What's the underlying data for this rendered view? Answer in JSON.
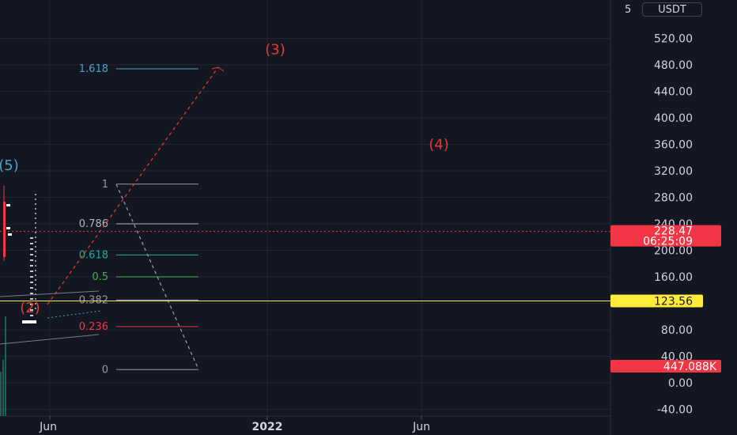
{
  "chart_data": {
    "type": "line",
    "quote_currency": "USDT",
    "y_ticks": [
      -40,
      0,
      40,
      80,
      120,
      160,
      200,
      240,
      280,
      320,
      360,
      400,
      440,
      480,
      520
    ],
    "y_tick_labels": [
      "-40.00",
      "0.00",
      "40.00",
      "80.00",
      "120.00",
      "160.00",
      "200.00",
      "240.00",
      "280.00",
      "320.00",
      "360.00",
      "400.00",
      "440.00",
      "480.00",
      "520.00"
    ],
    "top_axis_partial_label": "5",
    "x_labels": [
      {
        "text": "Jun",
        "bold": false
      },
      {
        "text": "2022",
        "bold": true
      },
      {
        "text": "Jun",
        "bold": false
      }
    ],
    "fib_levels": [
      {
        "ratio": "1.618",
        "color": "#4ba3c7",
        "value": 474
      },
      {
        "ratio": "1",
        "color": "#9598a1",
        "value": 300
      },
      {
        "ratio": "0.786",
        "color": "#b2b5be",
        "value": 240
      },
      {
        "ratio": "0.618",
        "color": "#22ab94",
        "value": 193
      },
      {
        "ratio": "0.5",
        "color": "#4caf50",
        "value": 160
      },
      {
        "ratio": "0.382",
        "color": "#9598a1",
        "value": 125
      },
      {
        "ratio": "0.236",
        "color": "#f23645",
        "value": 85
      },
      {
        "ratio": "0",
        "color": "#9598a1",
        "value": 20
      }
    ],
    "wave_labels": [
      {
        "text": "(3)",
        "color": "#e53935",
        "value": 496
      },
      {
        "text": "(4)",
        "color": "#e53935",
        "value": 353
      },
      {
        "text": "(2)",
        "color": "#e53935",
        "value": 106
      },
      {
        "text": "(5)",
        "color": "#4ba3c7",
        "value": 321
      }
    ],
    "current_price": {
      "value": 228.47,
      "label": "228.47",
      "countdown": "06:25:09",
      "color": "#f23645"
    },
    "horizontal_line": {
      "value": 123.56,
      "label": "123.56",
      "color": "#ffeb3b"
    },
    "volume_badge": {
      "label": "447.088K",
      "color": "#f23645"
    }
  }
}
